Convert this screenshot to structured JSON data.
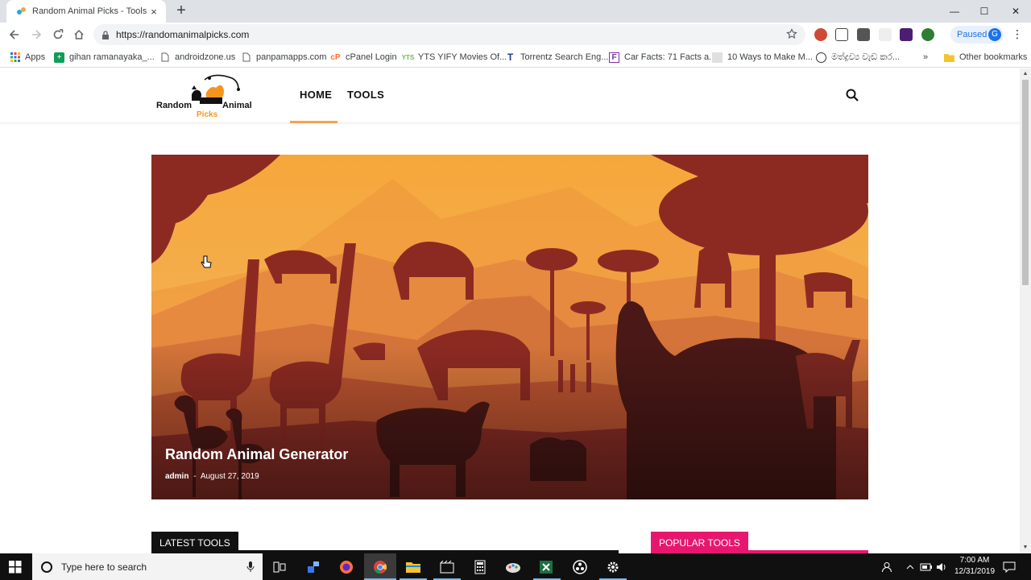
{
  "browser": {
    "tab": {
      "title": "Random Animal Picks - Tools to Generate Random Animals",
      "close": "×"
    },
    "new_tab": "+",
    "window_controls": {
      "minimize": "—",
      "maximize": "☐",
      "close": "✕"
    },
    "url": "https://randomanimalpicks.com",
    "profile": {
      "label": "Paused",
      "initial": "G"
    },
    "menu": "⋮",
    "bookmarks": [
      {
        "label": "Apps"
      },
      {
        "label": "gihan ramanayaka_..."
      },
      {
        "label": "androidzone.us"
      },
      {
        "label": "panpamapps.com"
      },
      {
        "label": "cPanel Login"
      },
      {
        "label": "YTS YIFY Movies Of..."
      },
      {
        "label": "Torrentz Search Eng..."
      },
      {
        "label": "Car Facts: 71 Facts a..."
      },
      {
        "label": "10 Ways to Make M..."
      },
      {
        "label": "මත්ද්‍රව්‍ය වැඩ කර..."
      },
      {
        "label": "»"
      },
      {
        "label": "Other bookmarks"
      }
    ]
  },
  "site": {
    "logo": {
      "word1": "Random",
      "word2": "Animal",
      "word3": "Picks"
    },
    "nav": [
      {
        "label": "HOME"
      },
      {
        "label": "TOOLS"
      }
    ],
    "hero": {
      "title": "Random Animal Generator",
      "author": "admin",
      "separator": "-",
      "date": "August 27, 2019"
    },
    "latest_label": "LATEST TOOLS",
    "popular_label": "POPULAR TOOLS"
  },
  "taskbar": {
    "search_placeholder": "Type here to search",
    "time": "7:00 AM",
    "date": "12/31/2019"
  },
  "colors": {
    "accent_orange": "#f3a54a",
    "popular_pink": "#e7176f",
    "latest_dark": "#111111"
  }
}
